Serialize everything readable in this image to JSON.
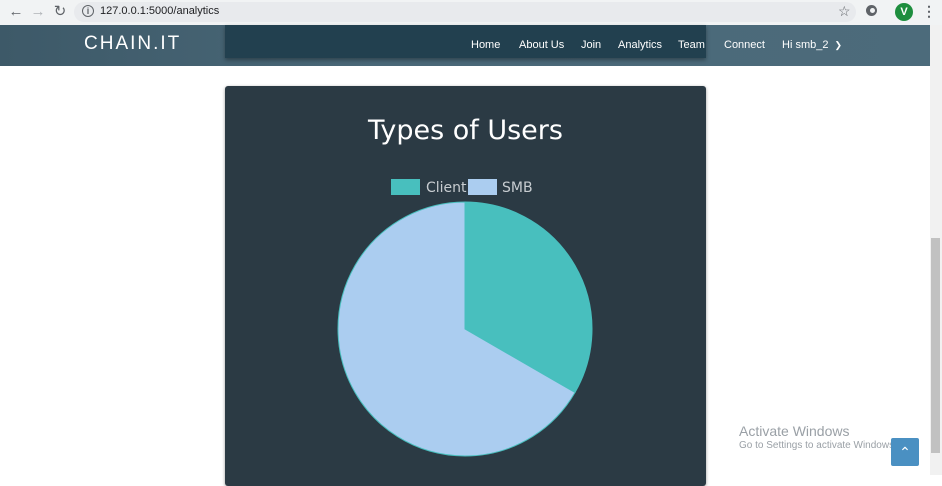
{
  "browser": {
    "url": "127.0.0.1:5000/analytics",
    "avatar_letter": "V"
  },
  "navbar": {
    "brand": "CHAIN.IT",
    "links": [
      "Home",
      "About Us",
      "Join",
      "Analytics",
      "Team",
      "Connect",
      "Hi smb_2"
    ]
  },
  "chart_data": {
    "type": "pie",
    "title": "Types of Users",
    "legend_position": "top",
    "labels": [
      "Client",
      "SMB"
    ],
    "values": [
      1,
      2
    ],
    "colors": [
      "#48bfbe",
      "#abcdf0"
    ]
  },
  "watermark": {
    "title": "Activate Windows",
    "subtitle": "Go to Settings to activate Windows."
  }
}
